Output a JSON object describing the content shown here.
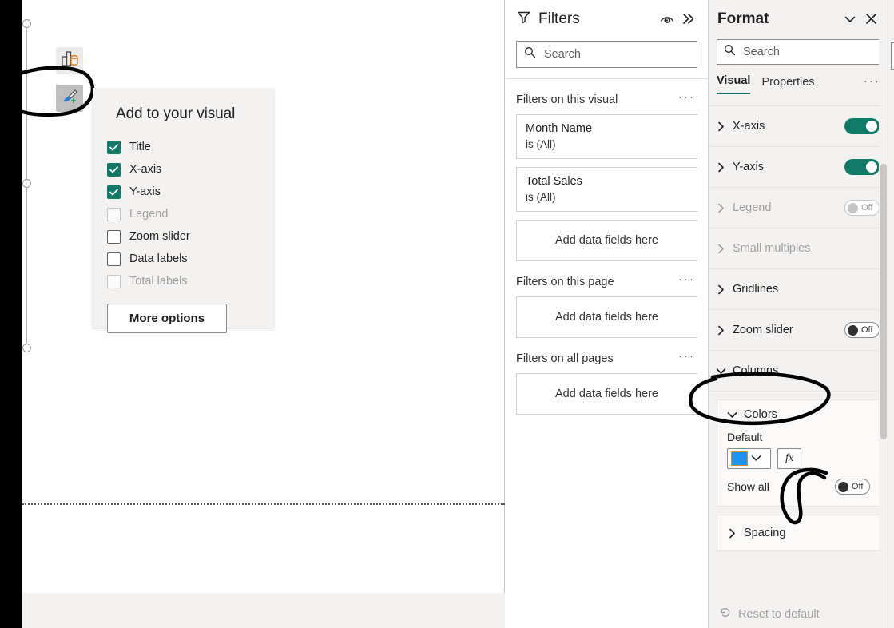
{
  "canvas": {
    "toolbar": [
      {
        "name": "build-visual",
        "icon": "bar-chart-cylinder-icon",
        "selected": false
      },
      {
        "name": "format-visual",
        "icon": "paintbrush-plus-icon",
        "selected": true
      }
    ],
    "flyout": {
      "title": "Add to your visual",
      "items": [
        {
          "label": "Title",
          "checked": true,
          "disabled": false
        },
        {
          "label": "X-axis",
          "checked": true,
          "disabled": false
        },
        {
          "label": "Y-axis",
          "checked": true,
          "disabled": false
        },
        {
          "label": "Legend",
          "checked": false,
          "disabled": true
        },
        {
          "label": "Zoom slider",
          "checked": false,
          "disabled": false
        },
        {
          "label": "Data labels",
          "checked": false,
          "disabled": false
        },
        {
          "label": "Total labels",
          "checked": false,
          "disabled": true
        }
      ],
      "more_options_label": "More options"
    }
  },
  "filters": {
    "title": "Filters",
    "header_icons": [
      {
        "name": "eye-icon"
      },
      {
        "name": "double-chevron-right-icon"
      }
    ],
    "search": {
      "placeholder": "Search"
    },
    "sections": [
      {
        "title": "Filters on this visual",
        "more": "···",
        "cards": [
          {
            "name": "Month Name",
            "value": "is (All)"
          },
          {
            "name": "Total Sales",
            "value": "is (All)"
          }
        ],
        "dropzone": "Add data fields here"
      },
      {
        "title": "Filters on this page",
        "more": "···",
        "cards": [],
        "dropzone": "Add data fields here"
      },
      {
        "title": "Filters on all pages",
        "more": "···",
        "cards": [],
        "dropzone": "Add data fields here"
      }
    ]
  },
  "format": {
    "title": "Format",
    "header_icons": [
      {
        "name": "chevron-down-icon"
      },
      {
        "name": "close-icon"
      }
    ],
    "search": {
      "placeholder": "Search"
    },
    "tabs": [
      {
        "label": "Visual",
        "active": true
      },
      {
        "label": "Properties",
        "active": false
      }
    ],
    "tabs_more": "···",
    "sections": [
      {
        "label": "X-axis",
        "expanded": false,
        "toggle": "On",
        "toggle_state": "on",
        "disabled": false
      },
      {
        "label": "Y-axis",
        "expanded": false,
        "toggle": "On",
        "toggle_state": "on",
        "disabled": false
      },
      {
        "label": "Legend",
        "expanded": false,
        "toggle": "Off",
        "toggle_state": "off",
        "disabled": true
      },
      {
        "label": "Small multiples",
        "expanded": false,
        "toggle": null,
        "toggle_state": null,
        "disabled": true
      },
      {
        "label": "Gridlines",
        "expanded": false,
        "toggle": null,
        "toggle_state": null,
        "disabled": false
      },
      {
        "label": "Zoom slider",
        "expanded": false,
        "toggle": "Off",
        "toggle_state": "off",
        "disabled": false
      },
      {
        "label": "Columns",
        "expanded": true,
        "toggle": null,
        "toggle_state": null,
        "disabled": false
      }
    ],
    "colors_card": {
      "title": "Colors",
      "default_label": "Default",
      "swatch_color": "#1f92f0",
      "fx_label": "fx",
      "show_all_label": "Show all",
      "show_all_toggle": "Off"
    },
    "spacing_card": {
      "title": "Spacing"
    },
    "reset_label": "Reset to default",
    "accent_color": "#0f7a68"
  },
  "annotations": [
    {
      "name": "ink-circle-format-icon",
      "target": "format-visual-toolbar-button"
    },
    {
      "name": "ink-circle-columns",
      "target": "columns-section"
    },
    {
      "name": "ink-circle-fx",
      "target": "fx-button"
    }
  ]
}
